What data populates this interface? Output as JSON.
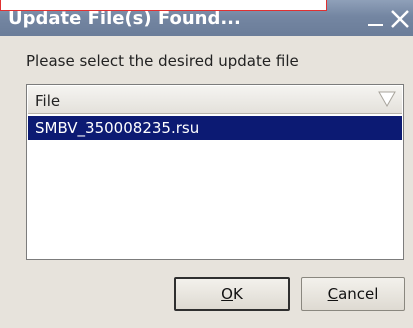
{
  "window": {
    "title": "Update File(s) Found..."
  },
  "dialog": {
    "prompt": "Please select the desired update file",
    "list": {
      "column_header": "File",
      "rows": [
        {
          "label": "SMBV_350008235.rsu",
          "selected": true
        }
      ]
    },
    "buttons": {
      "ok": {
        "mnemonic": "O",
        "rest": "K"
      },
      "cancel": {
        "mnemonic": "C",
        "rest": "ancel"
      }
    }
  },
  "colors": {
    "titlebar": "#7486a2",
    "selection": "#0c1a73",
    "dialog_background": "#e7e3dc"
  },
  "icons": {
    "minimize": "minimize-icon",
    "close": "close-icon",
    "sort": "sort-triangle-icon"
  }
}
